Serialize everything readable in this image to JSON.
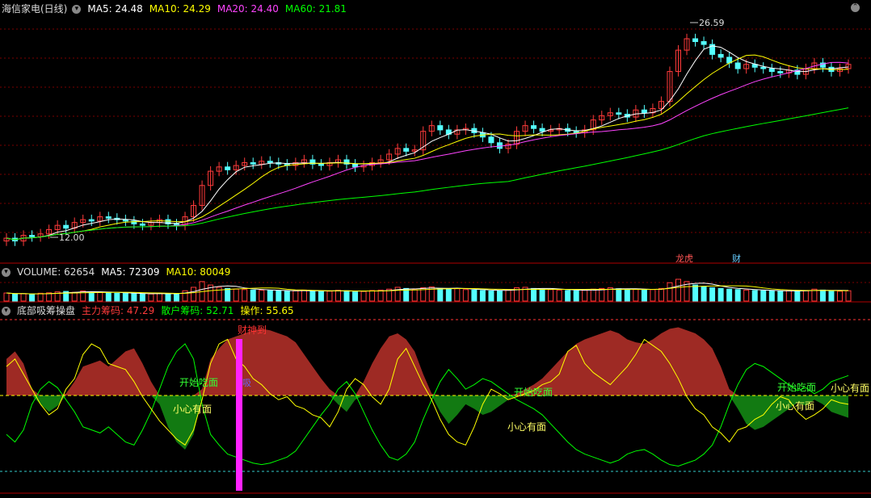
{
  "colors": {
    "up": "#ff3b3b",
    "down": "#54ffff",
    "ma5": "#ffffff",
    "ma10": "#ffff00",
    "ma20": "#ff44ff",
    "ma60": "#00ff00",
    "grid": "#7a0000",
    "main_fill": "#9e2a24",
    "retail_fill": "#127a12"
  },
  "price_panel": {
    "title": "海信家电(日线)",
    "ma5_label": "MA5: 24.48",
    "ma10_label": "MA10: 24.29",
    "ma20_label": "MA20: 24.40",
    "ma60_label": "MA60: 21.81",
    "high_label": "26.59",
    "low_label": "12.00",
    "marker1": "龙虎",
    "marker2": "财"
  },
  "volume_panel": {
    "label": "VOLUME: 62654",
    "ma5_label": "MA5: 72309",
    "ma10_label": "MA10: 80049"
  },
  "indicator_panel": {
    "title": "底部吸筹操盘",
    "main_label": "主力筹码: 47.29",
    "retail_label": "散户筹码: 52.71",
    "op_label": "操作: 55.65",
    "text_kaishi": "开始吃面",
    "text_xiaoxin": "小心有面",
    "text_caishen": "财神到",
    "text_xi": "吸"
  },
  "chart_data": [
    {
      "type": "candlestick",
      "title": "海信家电(日线)",
      "series": [
        {
          "name": "MA5",
          "value": 24.48
        },
        {
          "name": "MA10",
          "value": 24.29
        },
        {
          "name": "MA20",
          "value": 24.4
        },
        {
          "name": "MA60",
          "value": 21.81
        }
      ],
      "close": [
        12.3,
        12.1,
        12.5,
        12.4,
        12.6,
        12.9,
        13.2,
        13.0,
        13.4,
        13.6,
        13.5,
        13.8,
        13.7,
        13.6,
        13.5,
        13.3,
        13.2,
        13.4,
        13.6,
        13.3,
        13.2,
        13.8,
        14.6,
        16.0,
        17.0,
        17.3,
        17.1,
        17.4,
        17.6,
        17.5,
        17.7,
        17.6,
        17.5,
        17.4,
        17.6,
        17.8,
        17.5,
        17.4,
        17.6,
        17.8,
        17.5,
        17.3,
        17.4,
        17.6,
        17.8,
        18.2,
        18.6,
        18.4,
        18.5,
        19.8,
        20.2,
        19.9,
        19.6,
        19.9,
        20.0,
        19.7,
        19.4,
        19.0,
        18.6,
        18.9,
        19.8,
        20.2,
        20.0,
        19.8,
        19.9,
        20.0,
        19.8,
        19.7,
        19.9,
        20.6,
        20.9,
        21.1,
        21.0,
        20.8,
        21.3,
        21.1,
        21.4,
        21.9,
        24.0,
        25.5,
        26.3,
        26.1,
        25.9,
        25.2,
        25.0,
        24.6,
        24.2,
        24.5,
        24.3,
        24.2,
        24.0,
        23.9,
        24.1,
        23.8,
        24.2,
        24.6,
        24.3,
        24.0,
        24.2,
        24.5
      ],
      "annotations": [
        "26.59",
        "12.00"
      ]
    },
    {
      "type": "bar",
      "title": "VOLUME",
      "series": [
        {
          "name": "VOLUME",
          "value": 62654
        },
        {
          "name": "MA5",
          "value": 72309
        },
        {
          "name": "MA10",
          "value": 80049
        }
      ],
      "volumes": [
        35,
        30,
        32,
        28,
        34,
        36,
        40,
        42,
        38,
        44,
        40,
        38,
        36,
        34,
        33,
        32,
        30,
        31,
        34,
        33,
        32,
        45,
        60,
        85,
        70,
        60,
        55,
        52,
        50,
        48,
        47,
        46,
        44,
        43,
        45,
        48,
        44,
        42,
        43,
        47,
        45,
        40,
        42,
        46,
        48,
        52,
        60,
        55,
        50,
        58,
        62,
        55,
        52,
        54,
        50,
        48,
        46,
        44,
        45,
        50,
        58,
        60,
        55,
        52,
        50,
        48,
        46,
        45,
        47,
        52,
        55,
        58,
        54,
        50,
        52,
        48,
        50,
        55,
        80,
        95,
        85,
        70,
        62,
        58,
        55,
        52,
        50,
        48,
        46,
        45,
        44,
        43,
        45,
        44,
        46,
        52,
        48,
        44,
        43,
        45
      ]
    },
    {
      "type": "area",
      "title": "底部吸筹操盘",
      "series": [
        {
          "name": "主力筹码",
          "value": 47.29
        },
        {
          "name": "散户筹码",
          "value": 52.71
        },
        {
          "name": "操作",
          "value": 55.65
        }
      ],
      "main": [
        75,
        80,
        72,
        55,
        45,
        40,
        44,
        52,
        60,
        70,
        72,
        74,
        70,
        75,
        80,
        82,
        72,
        60,
        45,
        30,
        20,
        15,
        25,
        55,
        75,
        82,
        88,
        90,
        92,
        94,
        95,
        94,
        92,
        90,
        86,
        78,
        70,
        62,
        55,
        45,
        40,
        48,
        60,
        72,
        82,
        90,
        92,
        88,
        80,
        65,
        52,
        40,
        32,
        38,
        45,
        42,
        38,
        40,
        44,
        48,
        52,
        55,
        58,
        62,
        68,
        74,
        80,
        85,
        88,
        90,
        92,
        94,
        92,
        88,
        86,
        85,
        88,
        92,
        95,
        96,
        94,
        92,
        88,
        82,
        70,
        55,
        42,
        32,
        28,
        30,
        34,
        38,
        42,
        46,
        44,
        48,
        45,
        40,
        38,
        36
      ],
      "op": [
        70,
        75,
        65,
        55,
        45,
        38,
        42,
        55,
        62,
        78,
        85,
        82,
        72,
        70,
        68,
        60,
        50,
        42,
        34,
        28,
        22,
        18,
        28,
        48,
        72,
        85,
        88,
        75,
        70,
        62,
        58,
        52,
        48,
        50,
        44,
        42,
        38,
        36,
        30,
        40,
        55,
        62,
        58,
        50,
        45,
        55,
        75,
        82,
        70,
        58,
        48,
        35,
        25,
        20,
        18,
        30,
        45,
        55,
        52,
        48,
        50,
        52,
        54,
        58,
        60,
        65,
        80,
        84,
        72,
        66,
        62,
        58,
        64,
        70,
        78,
        88,
        84,
        80,
        72,
        62,
        50,
        42,
        38,
        30,
        26,
        20,
        28,
        30,
        35,
        38,
        45,
        50,
        48,
        40,
        35,
        38,
        42,
        48,
        46,
        45
      ]
    }
  ]
}
